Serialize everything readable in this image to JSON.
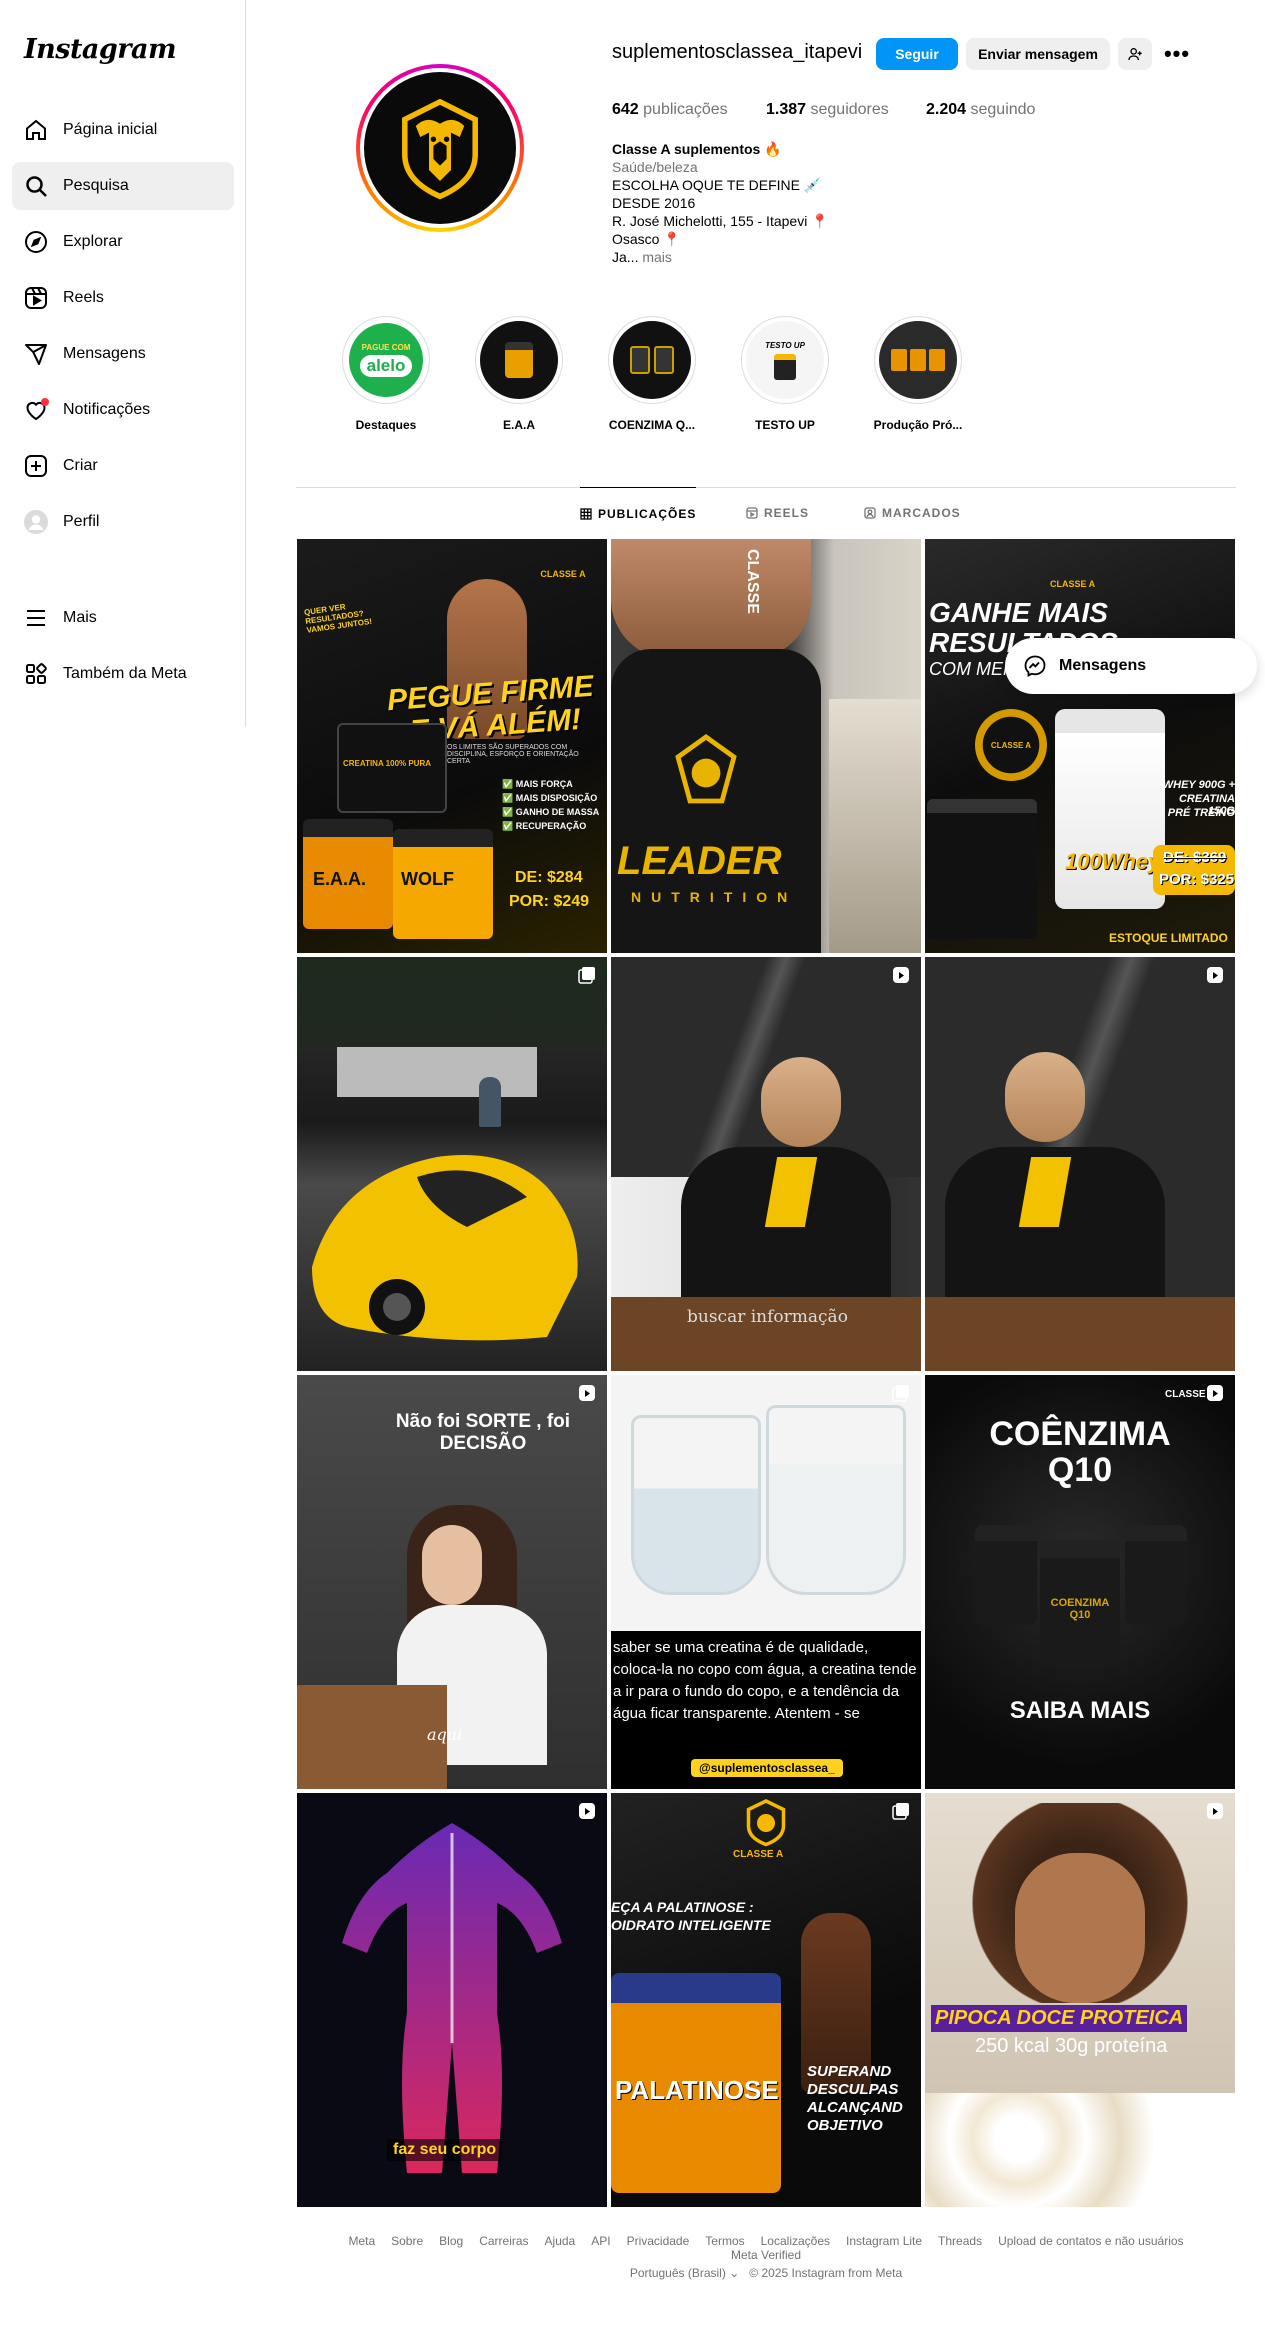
{
  "brand": {
    "logo_text": "Instagram"
  },
  "sidebar": {
    "items": [
      {
        "label": "Página inicial",
        "icon": "home-icon"
      },
      {
        "label": "Pesquisa",
        "icon": "search-icon"
      },
      {
        "label": "Explorar",
        "icon": "compass-icon"
      },
      {
        "label": "Reels",
        "icon": "reels-icon"
      },
      {
        "label": "Mensagens",
        "icon": "send-icon"
      },
      {
        "label": "Notificações",
        "icon": "heart-icon"
      },
      {
        "label": "Criar",
        "icon": "plus-icon"
      },
      {
        "label": "Perfil",
        "icon": "avatar-icon"
      }
    ],
    "more_label": "Mais",
    "meta_label": "Também da Meta"
  },
  "profile": {
    "username": "suplementosclassea_itapevi",
    "follow_label": "Seguir",
    "message_label": "Enviar mensagem",
    "stats": {
      "posts_count": "642",
      "posts_label": "publicações",
      "followers_count": "1.387",
      "followers_label": "seguidores",
      "following_count": "2.204",
      "following_label": "seguindo"
    },
    "bio": {
      "name": "Classe A suplementos 🔥",
      "category": "Saúde/beleza",
      "line1": "ESCOLHA OQUE TE DEFINE 💉",
      "line2": "DESDE 2016",
      "line3": "R. José Michelotti, 155 - Itapevi 📍",
      "line4": "Osasco 📍",
      "line5": "Ja...",
      "more": "mais"
    }
  },
  "highlights": [
    {
      "label": "Destaques"
    },
    {
      "label": "E.A.A"
    },
    {
      "label": "COENZIMA Q..."
    },
    {
      "label": "TESTO UP"
    },
    {
      "label": "Produção Pró..."
    }
  ],
  "highlight_texts": {
    "alelo_top": "PAGUE COM",
    "alelo_brand": "alelo",
    "testo": "TESTO UP"
  },
  "tabs": [
    {
      "label": "PUBLICAÇÕES",
      "active": true
    },
    {
      "label": "REELS",
      "active": false
    },
    {
      "label": "MARCADOS",
      "active": false
    }
  ],
  "posts": {
    "p1": {
      "top": "QUER VER RESULTADOS? VAMOS JUNTOS!",
      "brand": "CLASSE A",
      "headline1": "PEGUE FIRME",
      "headline2": "E VÁ ALÉM!",
      "sub": "OS LIMITES SÃO SUPERADOS COM DISCIPLINA, ESFORÇO E ORIENTAÇÃO CERTA",
      "b1": "MAIS FORÇA",
      "b2": "MAIS DISPOSIÇÃO",
      "b3": "GANHO DE MASSA",
      "b4": "RECUPERAÇÃO",
      "price_de": "DE: $284",
      "price_por": "POR: $249",
      "jar1": "CREATINA 100% PURA",
      "jar2": "E.A.A.",
      "jar3": "WOLF"
    },
    "p2": {
      "shirt1": "LEADER",
      "shirt2": "NUTRITION",
      "store": "CLASSE"
    },
    "p3": {
      "brand": "CLASSE A",
      "headline1": "GANHE MAIS",
      "headline2": "RESULTADOS",
      "headline3": "COM MENOS",
      "combo1": "WHEY 900G +",
      "combo2": "CREATINA 150G",
      "combo3": "PRÉ TREINO",
      "price_de": "DE: $369",
      "price_por": "POR: $325",
      "stock": "ESTOQUE LIMITADO",
      "jar": "100Whey",
      "seal": "CLASSE A"
    },
    "p5": {
      "caption": "buscar informação"
    },
    "p7": {
      "headline": "Não foi SORTE , foi DECISÃO",
      "caption": "aqui"
    },
    "p8": {
      "text": "saber se uma creatina é de qualidade, coloca-la no copo com água, a creatina tende a ir para o fundo do copo, e a tendência da água ficar transparente. Atentem - se",
      "tag": "@suplementosclassea_"
    },
    "p9": {
      "headline1": "COÊNZIMA",
      "headline2": "Q10",
      "cta": "SAIBA MAIS",
      "brand": "CLASSE",
      "jar": "COENZIMA Q10"
    },
    "p10": {
      "caption": "faz seu corpo"
    },
    "p11": {
      "brand": "CLASSE A",
      "headline1": "EÇA A PALATINOSE :",
      "headline2": "OIDRATO INTELIGENTE",
      "jar": "PALATINOSE",
      "side1": "SUPERAND",
      "side2": "DESCULPAS",
      "side3": "ALCANÇAND",
      "side4": "OBJETIVO"
    },
    "p12": {
      "headline": "PIPOCA DOCE PROTEICA",
      "sub": "250 kcal 30g proteína"
    }
  },
  "footer": {
    "links": [
      "Meta",
      "Sobre",
      "Blog",
      "Carreiras",
      "Ajuda",
      "API",
      "Privacidade",
      "Termos",
      "Localizações",
      "Instagram Lite",
      "Threads",
      "Upload de contatos e não usuários",
      "Meta Verified"
    ],
    "language": "Português (Brasil)",
    "copyright": "© 2025 Instagram from Meta"
  },
  "floating": {
    "messages_label": "Mensagens"
  },
  "colors": {
    "accent": "#0095f6",
    "gold": "#f5b800",
    "yellow_text": "#ffd21f"
  }
}
